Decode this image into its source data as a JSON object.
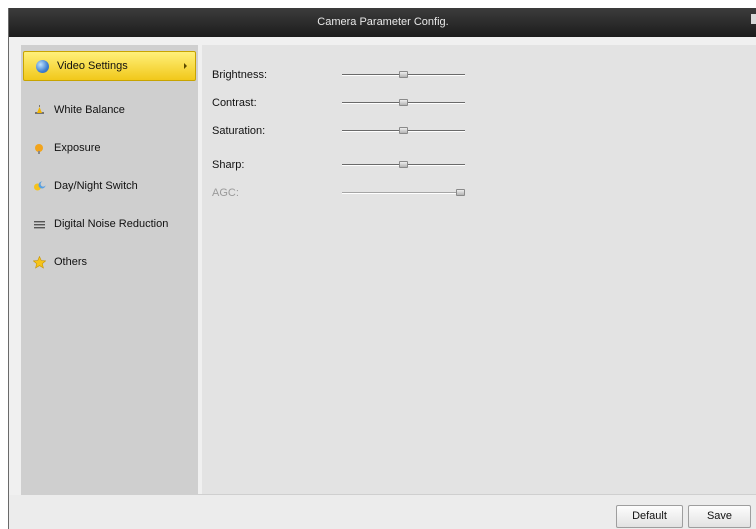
{
  "window": {
    "title": "Camera Parameter Config."
  },
  "sidebar": {
    "items": [
      {
        "label": "Video Settings",
        "icon": "video-settings-icon",
        "active": true
      },
      {
        "label": "White Balance",
        "icon": "white-balance-icon",
        "active": false
      },
      {
        "label": "Exposure",
        "icon": "exposure-icon",
        "active": false
      },
      {
        "label": "Day/Night Switch",
        "icon": "day-night-icon",
        "active": false
      },
      {
        "label": "Digital Noise Reduction",
        "icon": "noise-reduction-icon",
        "active": false
      },
      {
        "label": "Others",
        "icon": "star-icon",
        "active": false
      }
    ]
  },
  "params": [
    {
      "label": "Brightness:",
      "level": 0.5,
      "enabled": true
    },
    {
      "label": "Contrast:",
      "level": 0.5,
      "enabled": true
    },
    {
      "label": "Saturation:",
      "level": 0.5,
      "enabled": true
    },
    {
      "label": "Sharp:",
      "level": 0.5,
      "enabled": true
    },
    {
      "label": "AGC:",
      "level": 1.0,
      "enabled": false
    }
  ],
  "buttons": {
    "default_label": "Default",
    "save_label": "Save"
  },
  "colors": {
    "active_item": "#f6d52c",
    "titlebar": "#2a2a2a",
    "content_bg": "#e3e3e3",
    "sidebar_bg": "#cfcfcf"
  }
}
